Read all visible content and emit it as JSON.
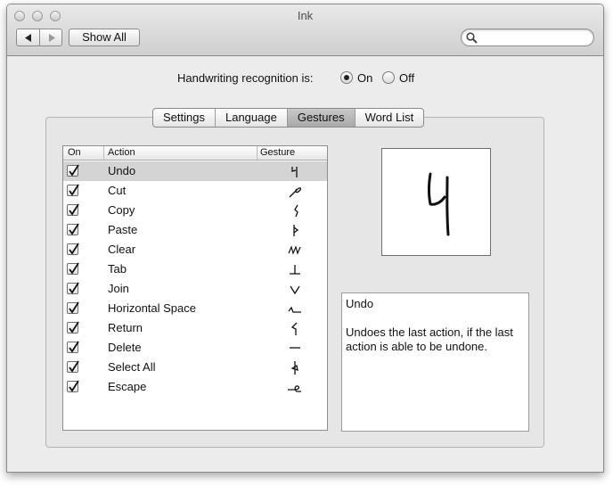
{
  "window": {
    "title": "Ink"
  },
  "toolbar": {
    "show_all_label": "Show All",
    "search_placeholder": ""
  },
  "recognition": {
    "label": "Handwriting recognition is:",
    "on_label": "On",
    "off_label": "Off",
    "selected": "On"
  },
  "tabs": [
    {
      "label": "Settings",
      "selected": false
    },
    {
      "label": "Language",
      "selected": false
    },
    {
      "label": "Gestures",
      "selected": true
    },
    {
      "label": "Word List",
      "selected": false
    }
  ],
  "table": {
    "columns": {
      "on": "On",
      "action": "Action",
      "gesture": "Gesture"
    },
    "rows": [
      {
        "on": true,
        "action": "Undo",
        "gesture_icon": "undo-gesture-icon",
        "selected": true
      },
      {
        "on": true,
        "action": "Cut",
        "gesture_icon": "cut-gesture-icon",
        "selected": false
      },
      {
        "on": true,
        "action": "Copy",
        "gesture_icon": "copy-gesture-icon",
        "selected": false
      },
      {
        "on": true,
        "action": "Paste",
        "gesture_icon": "paste-gesture-icon",
        "selected": false
      },
      {
        "on": true,
        "action": "Clear",
        "gesture_icon": "clear-gesture-icon",
        "selected": false
      },
      {
        "on": true,
        "action": "Tab",
        "gesture_icon": "tab-gesture-icon",
        "selected": false
      },
      {
        "on": true,
        "action": "Join",
        "gesture_icon": "join-gesture-icon",
        "selected": false
      },
      {
        "on": true,
        "action": "Horizontal Space",
        "gesture_icon": "horizontal-space-gesture-icon",
        "selected": false
      },
      {
        "on": true,
        "action": "Return",
        "gesture_icon": "return-gesture-icon",
        "selected": false
      },
      {
        "on": true,
        "action": "Delete",
        "gesture_icon": "delete-gesture-icon",
        "selected": false
      },
      {
        "on": true,
        "action": "Select All",
        "gesture_icon": "select-all-gesture-icon",
        "selected": false
      },
      {
        "on": true,
        "action": "Escape",
        "gesture_icon": "escape-gesture-icon",
        "selected": false
      }
    ]
  },
  "description": {
    "title": "Undo",
    "text": "Undoes the last action, if the last action is able to be undone."
  },
  "colors": {
    "selected_row": "#d4d4d4",
    "window_bg": "#ececec"
  }
}
